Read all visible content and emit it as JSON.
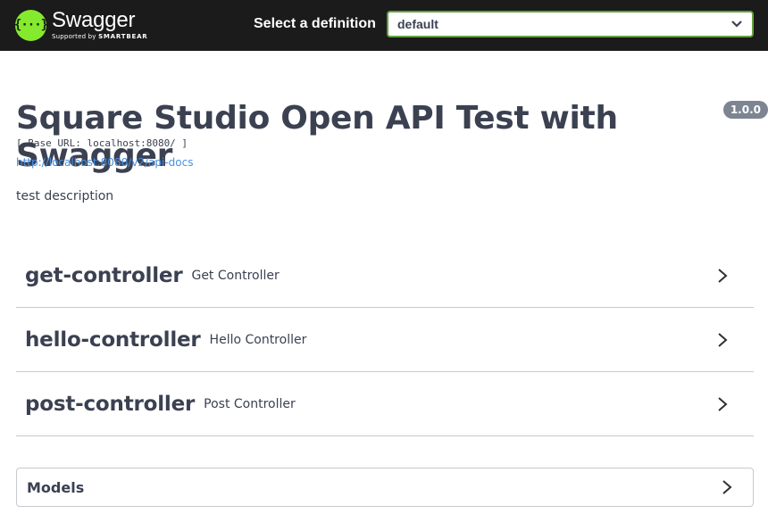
{
  "topbar": {
    "brand_name": "Swagger",
    "brand_sub_prefix": "Supported by",
    "brand_sub_company": "SMARTBEAR",
    "logo_glyph": "{···}",
    "select_label": "Select a definition",
    "select_value": "default",
    "colors": {
      "background": "#1b1b1b",
      "logo": "#85ea2d",
      "select_border": "#62a03f"
    }
  },
  "info": {
    "title": "Square Studio Open API Test with Swagger",
    "version": "1.0.0",
    "base_url": "[ Base URL: localhost:8080/ ]",
    "docs_link": "http://localhost:8080/v2/api-docs",
    "description": "test description"
  },
  "tags": [
    {
      "name": "get-controller",
      "description": "Get Controller",
      "icon": "chevron-right-icon"
    },
    {
      "name": "hello-controller",
      "description": "Hello Controller",
      "icon": "chevron-right-icon"
    },
    {
      "name": "post-controller",
      "description": "Post Controller",
      "icon": "chevron-right-icon"
    }
  ],
  "models": {
    "label": "Models",
    "icon": "chevron-right-icon"
  }
}
